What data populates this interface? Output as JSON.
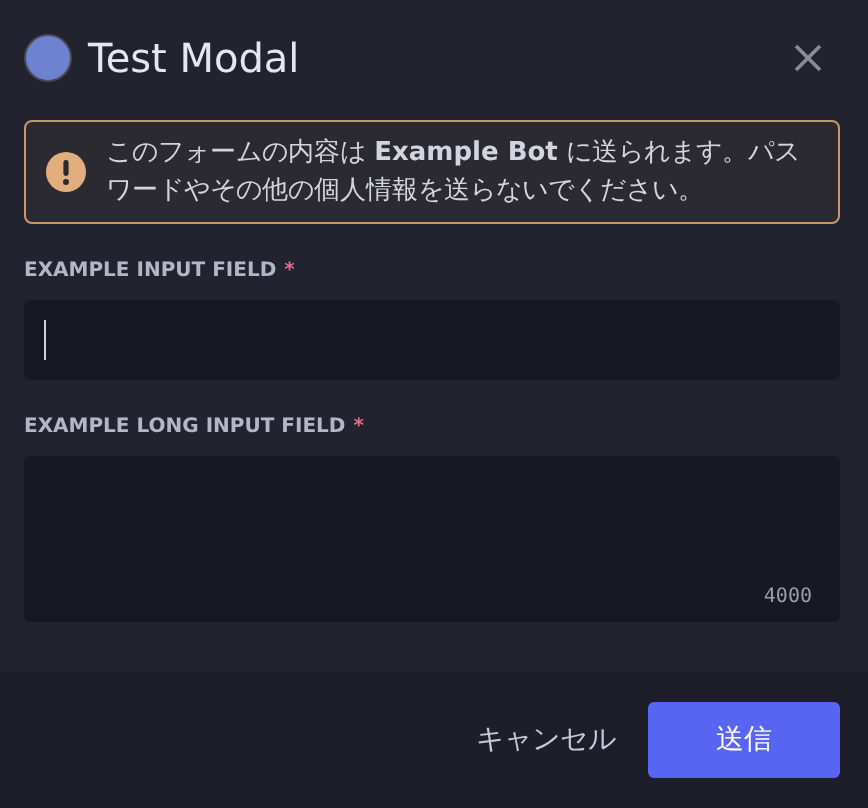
{
  "window": {
    "title": "Test Modal"
  },
  "notice": {
    "text": "このフォームの内容は **Example Bot** に送られます。パスワードやその他の個人情報を送らないでください。"
  },
  "fields": [
    {
      "kind": "input",
      "label": "EXAMPLE INPUT FIELD",
      "required_mark": "*",
      "focused": true
    },
    {
      "kind": "textarea",
      "label": "EXAMPLE LONG INPUT FIELD",
      "required_mark": "*",
      "focused": false,
      "counter": "4000"
    }
  ],
  "buttons": [
    {
      "kind": "link",
      "label": "キャンセル"
    },
    {
      "kind": "primary",
      "label": "送信"
    }
  ]
}
